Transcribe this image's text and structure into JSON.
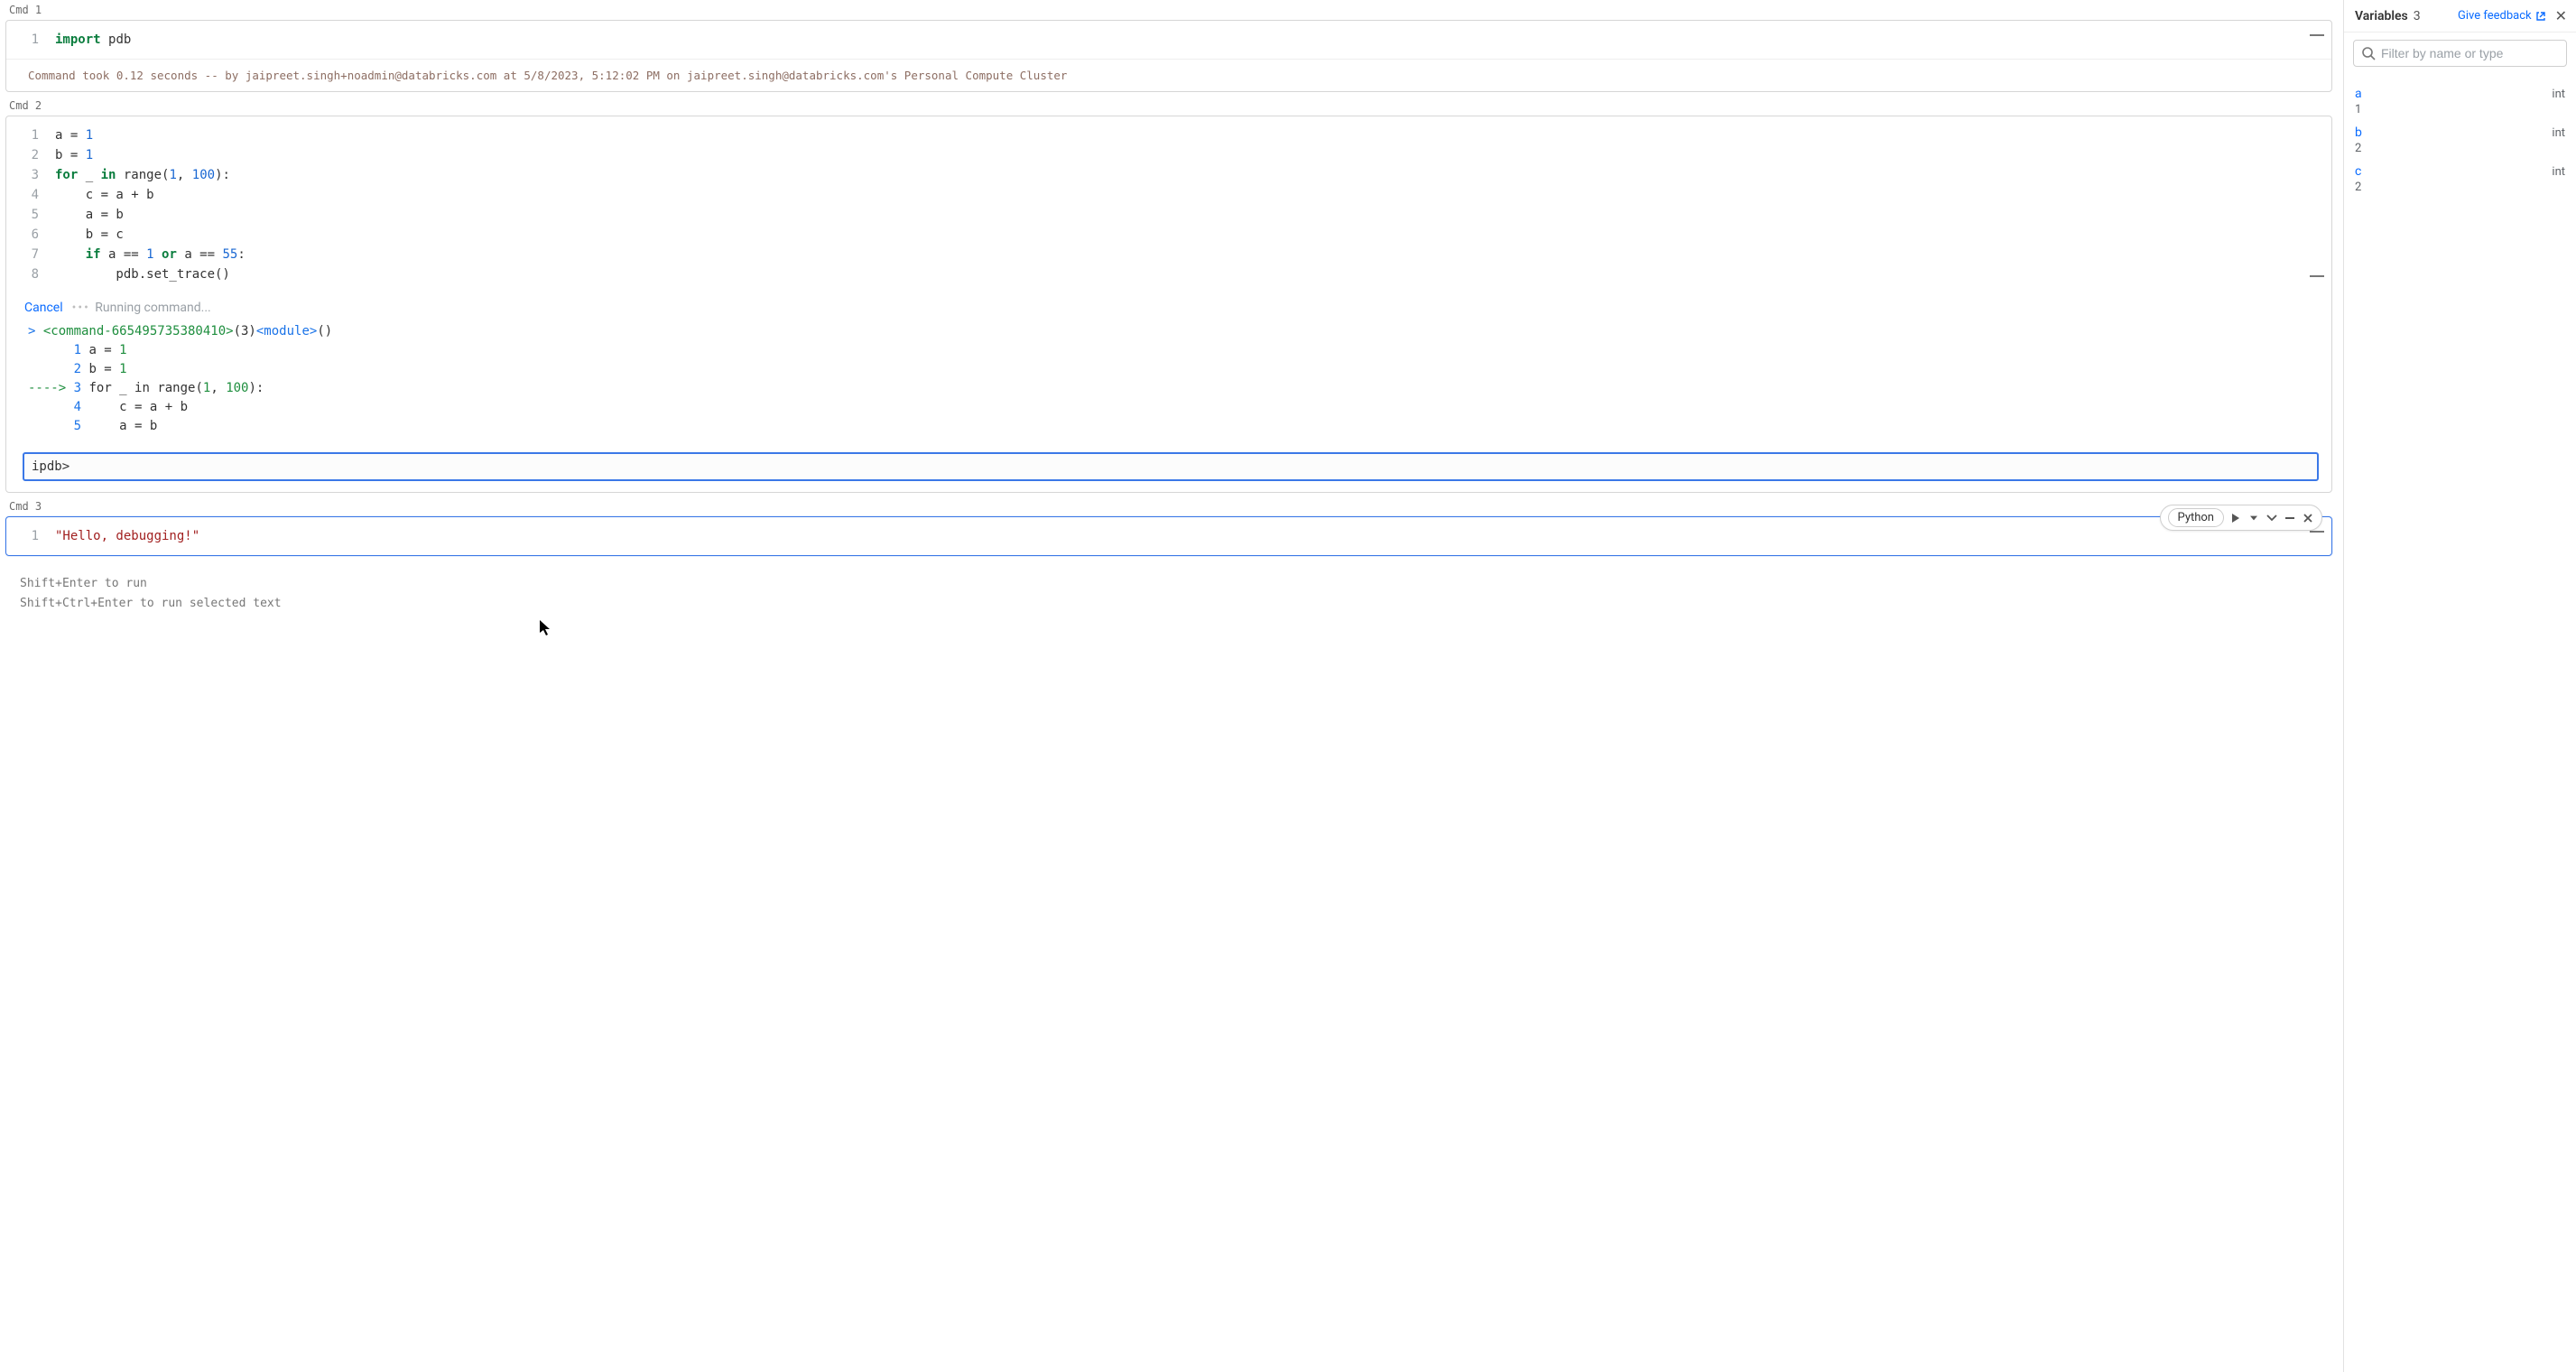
{
  "cells": {
    "cmd1": {
      "label": "Cmd 1",
      "lines": [
        {
          "n": "1",
          "tokens": [
            [
              "kw",
              "import"
            ],
            [
              "",
              " "
            ],
            [
              "fn",
              "pdb"
            ]
          ]
        }
      ],
      "status": "Command took 0.12 seconds -- by jaipreet.singh+noadmin@databricks.com at 5/8/2023, 5:12:02 PM on jaipreet.singh@databricks.com's Personal Compute Cluster"
    },
    "cmd2": {
      "label": "Cmd 2",
      "lines": [
        {
          "n": "1",
          "tokens": [
            [
              "",
              "a = "
            ],
            [
              "num",
              "1"
            ]
          ]
        },
        {
          "n": "2",
          "tokens": [
            [
              "",
              "b = "
            ],
            [
              "num",
              "1"
            ]
          ]
        },
        {
          "n": "3",
          "tokens": [
            [
              "kw",
              "for"
            ],
            [
              "",
              " _ "
            ],
            [
              "kw",
              "in"
            ],
            [
              "",
              " range("
            ],
            [
              "num",
              "1"
            ],
            [
              "",
              ", "
            ],
            [
              "num",
              "100"
            ],
            [
              "",
              "):"
            ]
          ]
        },
        {
          "n": "4",
          "tokens": [
            [
              "",
              "    c = a + b"
            ]
          ]
        },
        {
          "n": "5",
          "tokens": [
            [
              "",
              "    a = b"
            ]
          ]
        },
        {
          "n": "6",
          "tokens": [
            [
              "",
              "    b = c"
            ]
          ]
        },
        {
          "n": "7",
          "tokens": [
            [
              "",
              "    "
            ],
            [
              "kw",
              "if"
            ],
            [
              "",
              " a == "
            ],
            [
              "num",
              "1"
            ],
            [
              "",
              " "
            ],
            [
              "kw",
              "or"
            ],
            [
              "",
              " a == "
            ],
            [
              "num",
              "55"
            ],
            [
              "",
              ":"
            ]
          ]
        },
        {
          "n": "8",
          "tokens": [
            [
              "",
              "        pdb.set_trace()"
            ]
          ]
        }
      ],
      "cancel": "Cancel",
      "running": "Running command...",
      "trace": {
        "header": {
          "pre": "> ",
          "id": "<command-665495735380410>",
          "ln": "(3)",
          "mod": "<module>",
          "post": "()"
        },
        "lines": [
          {
            "prefix": "     ",
            "ln": "1",
            "code": [
              [
                "",
                " a = "
              ],
              [
                "tok-num",
                "1"
              ]
            ]
          },
          {
            "prefix": "     ",
            "ln": "2",
            "code": [
              [
                "",
                " b = "
              ],
              [
                "tok-num",
                "1"
              ]
            ]
          },
          {
            "prefix": "---->",
            "ln": "3",
            "code": [
              [
                "",
                " "
              ],
              [
                "",
                "for"
              ],
              [
                "",
                " _ "
              ],
              [
                "",
                "in"
              ],
              [
                "",
                " range("
              ],
              [
                "tok-num",
                "1"
              ],
              [
                "",
                ", "
              ],
              [
                "tok-num",
                "100"
              ],
              [
                "",
                "):"
              ]
            ]
          },
          {
            "prefix": "     ",
            "ln": "4",
            "code": [
              [
                "",
                "     c = a + b"
              ]
            ]
          },
          {
            "prefix": "     ",
            "ln": "5",
            "code": [
              [
                "",
                "     a = b"
              ]
            ]
          }
        ]
      },
      "ipdb_prompt": "ipdb>"
    },
    "cmd3": {
      "label": "Cmd 3",
      "language": "Python",
      "lines": [
        {
          "n": "1",
          "tokens": [
            [
              "str",
              "\"Hello, debugging!\""
            ]
          ]
        }
      ]
    }
  },
  "hints": {
    "line1": "Shift+Enter to run",
    "line2": "Shift+Ctrl+Enter to run selected text"
  },
  "sidebar": {
    "title": "Variables",
    "count": "3",
    "feedback": "Give feedback",
    "filter_placeholder": "Filter by name or type",
    "vars": [
      {
        "name": "a",
        "type": "int",
        "value": "1"
      },
      {
        "name": "b",
        "type": "int",
        "value": "2"
      },
      {
        "name": "c",
        "type": "int",
        "value": "2"
      }
    ]
  }
}
